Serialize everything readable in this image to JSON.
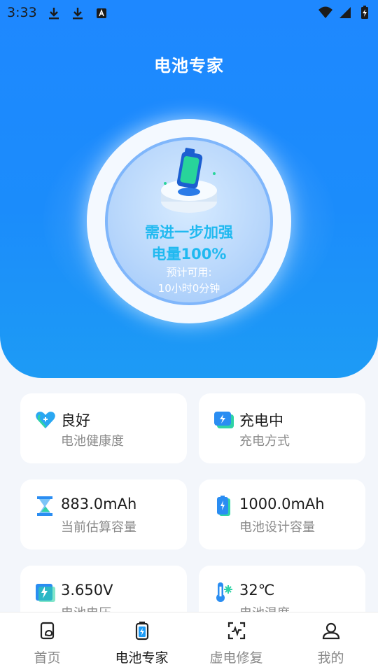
{
  "status_bar": {
    "time": "3:33",
    "left_icons": [
      "download-icon",
      "download-icon",
      "keyboard-a-icon"
    ],
    "right_icons": [
      "wifi-icon",
      "signal-icon",
      "battery-charging-icon"
    ]
  },
  "header": {
    "title": "电池专家"
  },
  "gauge": {
    "headline": "需进一步加强",
    "charge_text": "电量100%",
    "charge_percent": 100,
    "estimate_label": "预计可用:",
    "estimate_value": "10小时0分钟"
  },
  "cards": [
    {
      "icon": "heart-icon",
      "value": "良好",
      "label": "电池健康度"
    },
    {
      "icon": "charging-icon",
      "value": "充电中",
      "label": "充电方式"
    },
    {
      "icon": "hourglass-icon",
      "value": "883.0mAh",
      "label": "当前估算容量"
    },
    {
      "icon": "battery-icon",
      "value": "1000.0mAh",
      "label": "电池设计容量"
    },
    {
      "icon": "voltage-icon",
      "value": "3.650V",
      "label": "电池电压"
    },
    {
      "icon": "thermometer-icon",
      "value": "32℃",
      "label": "电池温度"
    }
  ],
  "bottom_nav": {
    "items": [
      {
        "icon": "home-icon",
        "label": "首页",
        "active": false
      },
      {
        "icon": "battery-expert-icon",
        "label": "电池专家",
        "active": true
      },
      {
        "icon": "scan-repair-icon",
        "label": "虚电修复",
        "active": false
      },
      {
        "icon": "profile-icon",
        "label": "我的",
        "active": false
      }
    ]
  },
  "colors": {
    "hero_blue": "#1e88ff",
    "accent_cyan": "#20b9f0",
    "active_nav": "#1c1c1c",
    "inactive_nav": "#888888"
  }
}
